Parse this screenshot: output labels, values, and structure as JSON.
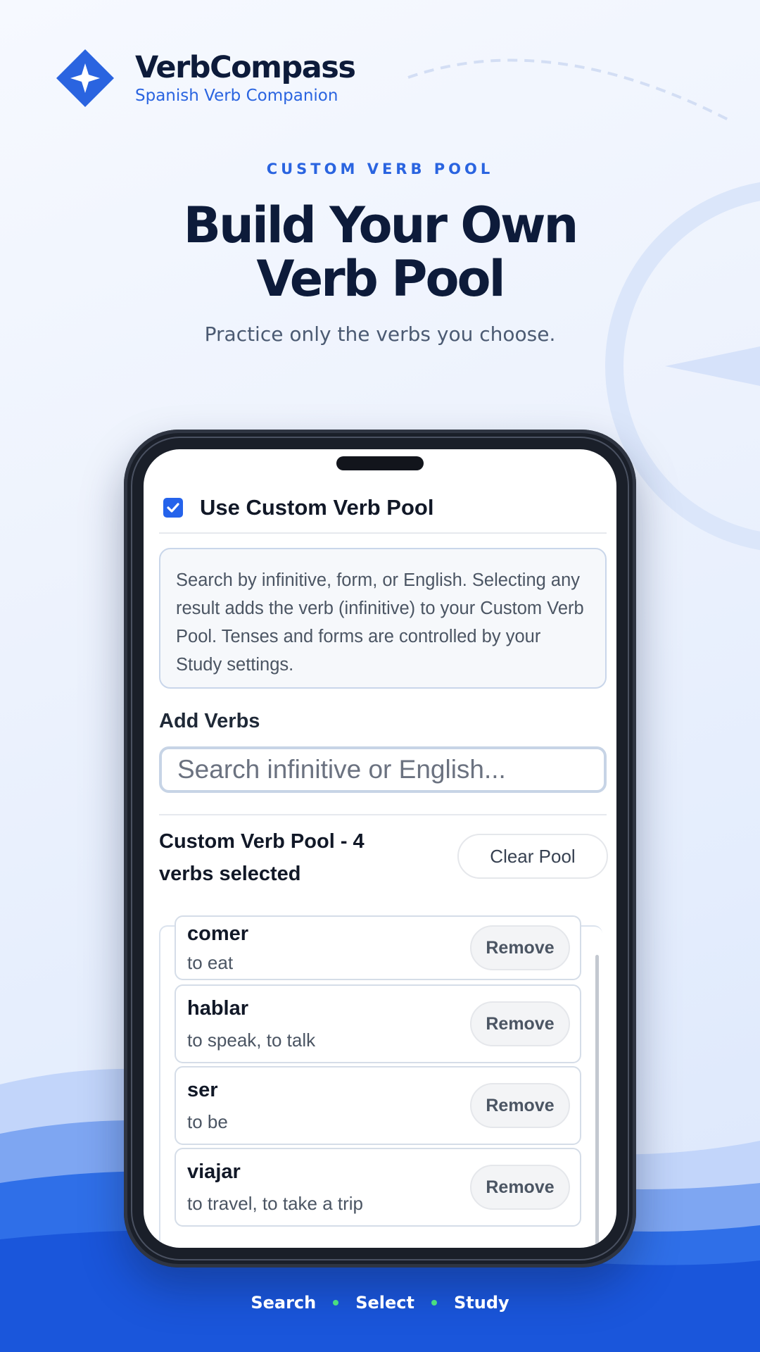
{
  "brand": {
    "name": "VerbCompass",
    "tagline": "Spanish Verb Companion",
    "logo_icon": "compass-star-icon"
  },
  "hero": {
    "eyebrow": "CUSTOM VERB POOL",
    "headline_line1": "Build Your Own",
    "headline_line2": "Verb Pool",
    "subhead": "Practice only the verbs you choose."
  },
  "app": {
    "toggle": {
      "label": "Use Custom Verb Pool",
      "checked": true
    },
    "info_text": "Search by infinitive, form, or English. Selecting any result adds the verb (infinitive) to your Custom Verb Pool. Tenses and forms are controlled by your Study settings.",
    "add_section_title": "Add Verbs",
    "search": {
      "placeholder": "Search infinitive or English...",
      "value": ""
    },
    "pool": {
      "title": "Custom Verb Pool - 4 verbs selected",
      "clear_label": "Clear Pool",
      "remove_label": "Remove",
      "verbs": [
        {
          "infinitive": "comer",
          "meaning": "to eat"
        },
        {
          "infinitive": "hablar",
          "meaning": "to speak, to talk"
        },
        {
          "infinitive": "ser",
          "meaning": "to be"
        },
        {
          "infinitive": "viajar",
          "meaning": "to travel, to take a trip"
        }
      ]
    }
  },
  "footer": {
    "steps": [
      "Search",
      "Select",
      "Study"
    ]
  },
  "colors": {
    "accent": "#2a64e0",
    "checkbox": "#2563eb",
    "dark_text": "#0d1b3a",
    "footer_dot": "#4ade80",
    "wave_dark": "#1a56db"
  }
}
